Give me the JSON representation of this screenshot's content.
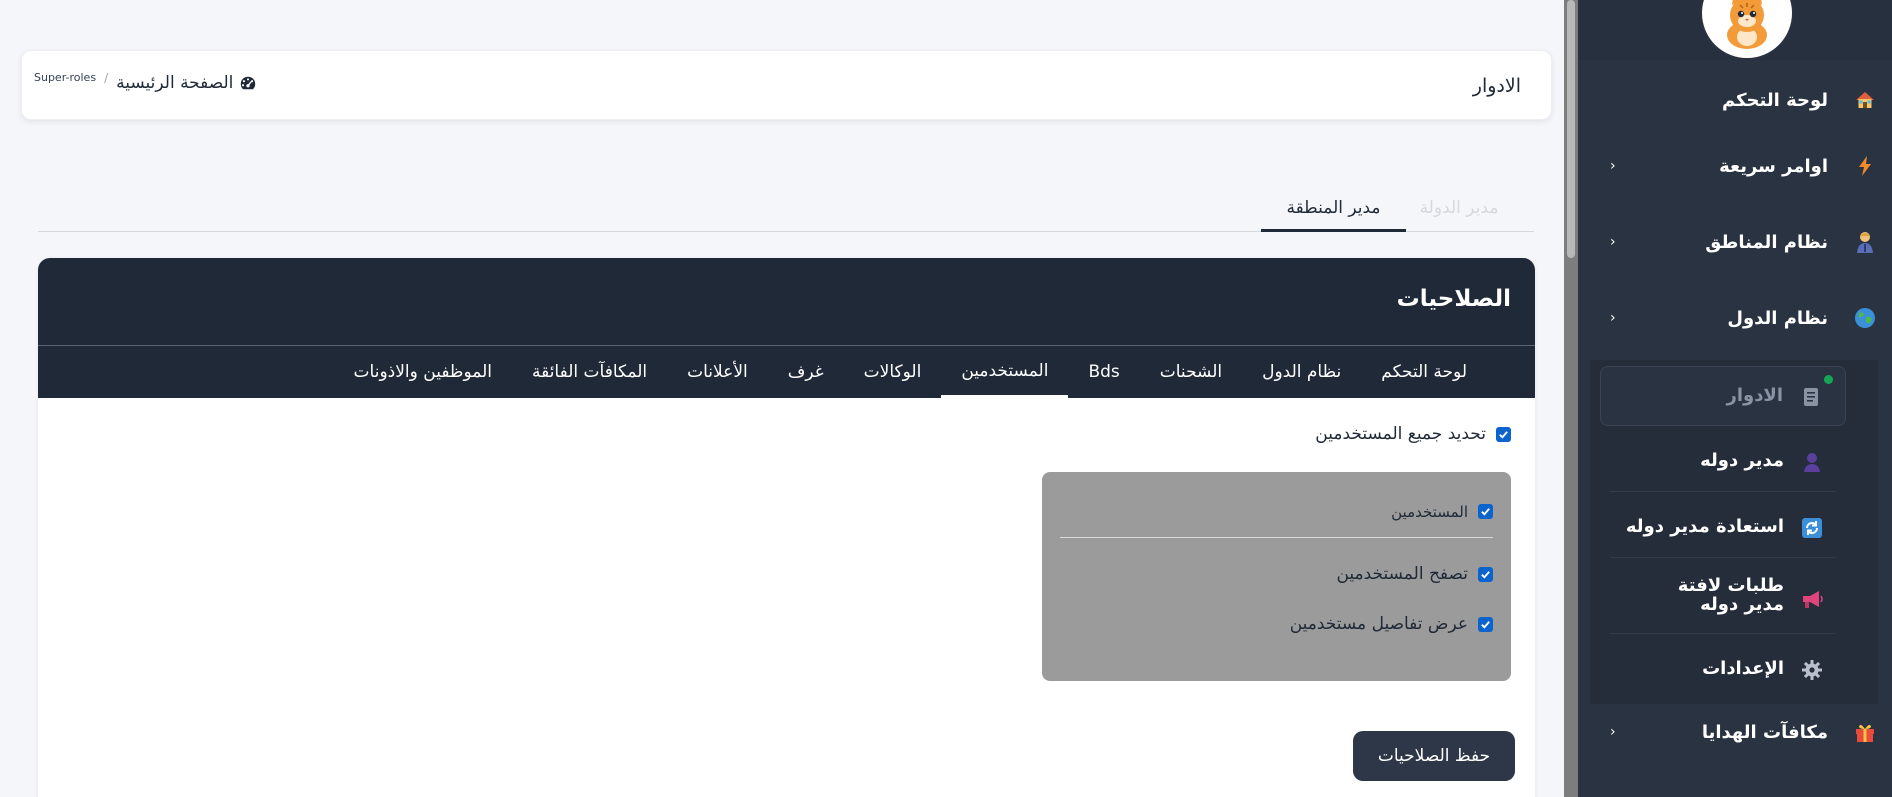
{
  "header": {
    "page_title": "الادوار",
    "breadcrumb_home": "الصفحة الرئيسية",
    "breadcrumb_current": "Super-roles",
    "breadcrumb_separator": "/"
  },
  "top_tabs": [
    {
      "label": "مدير المنطقة",
      "active": true
    },
    {
      "label": "مدير الدولة",
      "active": false
    }
  ],
  "permissions": {
    "title": "الصلاحيات",
    "tabs": [
      {
        "label": "لوحة التحكم"
      },
      {
        "label": "نظام الدول"
      },
      {
        "label": "الشحنات"
      },
      {
        "label": "Bds"
      },
      {
        "label": "المستخدمين",
        "active": true
      },
      {
        "label": "الوكالات"
      },
      {
        "label": "غرف"
      },
      {
        "label": "الأعلانات"
      },
      {
        "label": "المكافآت الفائقة"
      },
      {
        "label": "الموظفين والاذونات"
      }
    ],
    "select_all_label": "تحديد جميع المستخدمين",
    "group": {
      "title": "المستخدمين",
      "items": [
        "تصفح المستخدمين",
        "عرض تفاصيل مستخدمين"
      ]
    },
    "save_label": "حفظ الصلاحيات"
  },
  "sidebar": {
    "items": [
      {
        "label": "لوحة التحكم",
        "icon": "house-icon"
      },
      {
        "label": "اوامر سريعة",
        "icon": "lightning-icon"
      },
      {
        "label": "نظام المناطق",
        "icon": "person-icon"
      },
      {
        "label": "نظام الدول",
        "icon": "globe-icon"
      }
    ],
    "submenu": [
      {
        "label": "الادوار",
        "icon": "scroll-icon",
        "active": true
      },
      {
        "label": "مدير دوله",
        "icon": "user-icon"
      },
      {
        "label": "استعادة مدير دوله",
        "icon": "refresh-icon"
      },
      {
        "label": "طلبات لافتة مدير دوله",
        "icon": "megaphone-icon"
      },
      {
        "label": "الإعدادات",
        "icon": "gear-icon"
      }
    ],
    "bottom_item": {
      "label": "مكافآت الهدايا",
      "icon": "gift-icon"
    }
  },
  "colors": {
    "sidebar_bg": "#2a3342",
    "card_header_bg": "#1f2937",
    "checkbox": "#0b63ce",
    "group_bg": "#9b9b9b",
    "save_button": "#2d3748"
  }
}
